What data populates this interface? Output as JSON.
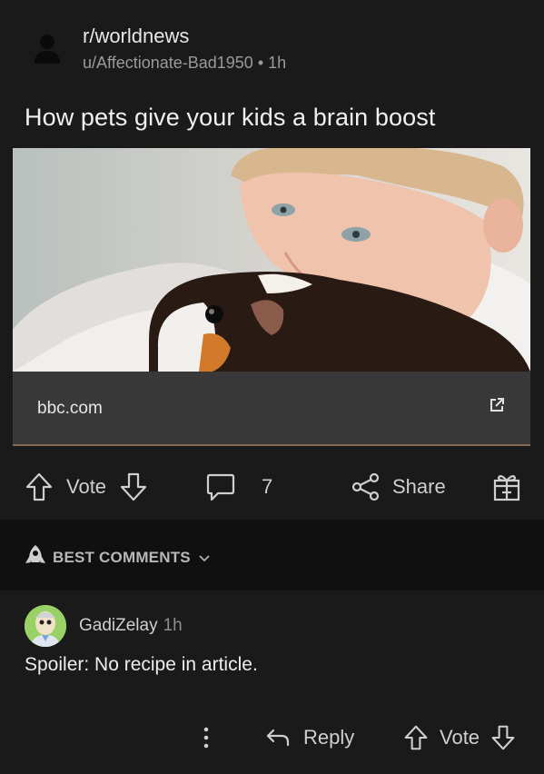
{
  "post": {
    "subreddit": "r/worldnews",
    "author": "u/Affectionate-Bad1950",
    "separator": "•",
    "time": "1h",
    "title": "How pets give your kids a brain boost"
  },
  "link": {
    "domain": "bbc.com"
  },
  "actions": {
    "vote_label": "Vote",
    "comment_count": "7",
    "share_label": "Share"
  },
  "comments_section": {
    "sort_label": "BEST COMMENTS"
  },
  "comment": {
    "author": "GadiZelay",
    "time": "1h",
    "text": "Spoiler: No recipe in article.",
    "reply_label": "Reply",
    "vote_label": "Vote"
  }
}
